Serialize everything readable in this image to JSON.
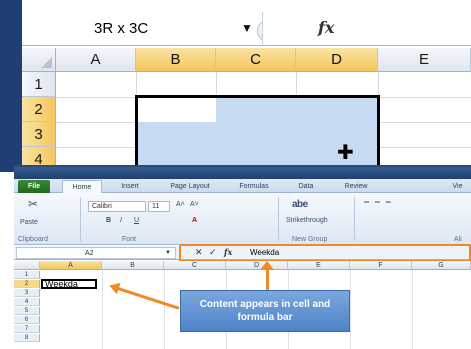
{
  "top": {
    "name_box_value": "3R x 3C",
    "name_box_arrow": "▼",
    "fx_label": "fx",
    "columns": [
      "A",
      "B",
      "C",
      "D",
      "E"
    ],
    "rows": [
      "1",
      "2",
      "3",
      "4"
    ],
    "selected_columns": [
      "B",
      "C",
      "D"
    ],
    "selected_rows": [
      "2",
      "3",
      "4"
    ],
    "cursor_glyph": "✚"
  },
  "window": {
    "tabs": [
      "File",
      "Home",
      "Insert",
      "Page Layout",
      "Formulas",
      "Data",
      "Review",
      "Vie"
    ],
    "ribbon": {
      "paste_label": "Paste",
      "clipboard_label": "Clipboard",
      "font_name": "Calibri",
      "font_size": "11",
      "grow_font": "A˄",
      "shrink_font": "A˅",
      "bold": "B",
      "italic": "I",
      "underline": "U",
      "font_color": "A",
      "font_label": "Font",
      "strikethrough_sample": "abe",
      "strikethrough_label": "Strikethrough",
      "new_group_label": "New Group",
      "alignment_label": "Ali"
    },
    "formula_bar": {
      "name_box_value": "A2",
      "name_box_arrow": "▼",
      "cancel": "✕",
      "enter": "✓",
      "fx_label": "fx",
      "content": "Weekda"
    },
    "columns": [
      "A",
      "B",
      "C",
      "D",
      "E",
      "F",
      "G"
    ],
    "rows": [
      "1",
      "2",
      "3",
      "4",
      "5",
      "6",
      "7",
      "8"
    ],
    "cell_a2_value": "Weekda",
    "callout_text": "Content appears in cell and formula bar"
  },
  "colors": {
    "accent_orange": "#f08a24",
    "selection_blue": "#c6dbf2",
    "header_selected": "#f3c75f",
    "callout_blue": "#4f84c7",
    "file_tab_green": "#1f6b1f"
  }
}
